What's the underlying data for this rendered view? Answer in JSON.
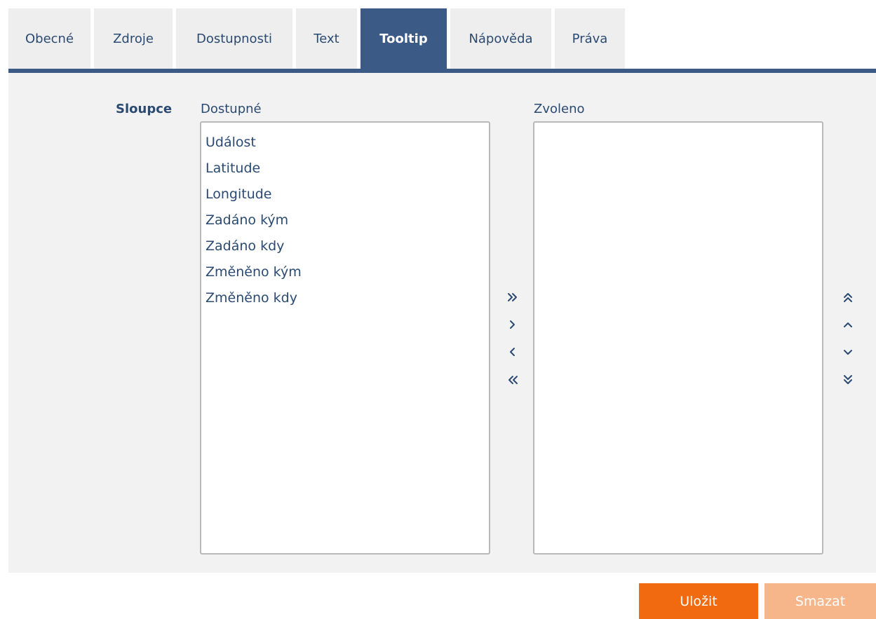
{
  "tabs": [
    {
      "label": "Obecné"
    },
    {
      "label": "Zdroje"
    },
    {
      "label": "Dostupnosti"
    },
    {
      "label": "Text"
    },
    {
      "label": "Tooltip"
    },
    {
      "label": "Nápověda"
    },
    {
      "label": "Práva"
    }
  ],
  "active_tab": "Tooltip",
  "form": {
    "field_label": "Sloupce",
    "available_caption": "Dostupné",
    "selected_caption": "Zvoleno",
    "available_items": [
      "Událost",
      "Latitude",
      "Longitude",
      "Zadáno kým",
      "Zadáno kdy",
      "Změněno kým",
      "Změněno kdy"
    ],
    "selected_items": []
  },
  "icons": {
    "move_all_right": "double-chevron-right-icon",
    "move_right": "chevron-right-icon",
    "move_left": "chevron-left-icon",
    "move_all_left": "double-chevron-left-icon",
    "move_top": "double-chevron-up-icon",
    "move_up": "chevron-up-icon",
    "move_down": "chevron-down-icon",
    "move_bottom": "double-chevron-down-icon"
  },
  "actions": {
    "save_label": "Uložit",
    "delete_label": "Smazat"
  },
  "colors": {
    "accent": "#3b5a86",
    "text": "#2b4a72",
    "tab_bg": "#eeeeee",
    "panel_bg": "#f2f2f2",
    "save_bg": "#f26a10",
    "delete_bg": "#f7b68a"
  }
}
